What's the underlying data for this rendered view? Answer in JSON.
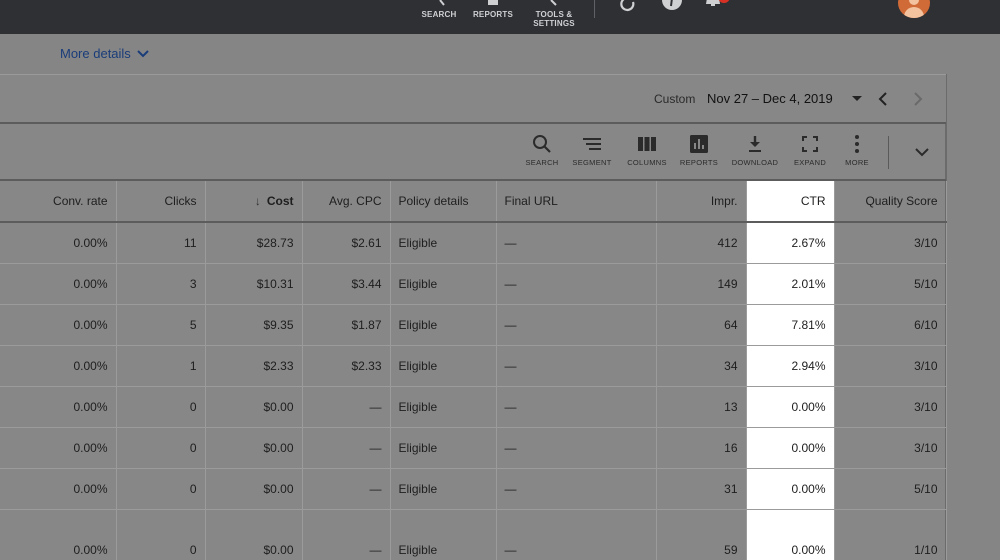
{
  "topnav": {
    "items": [
      {
        "label": "SEARCH",
        "icon": "search-icon"
      },
      {
        "label": "REPORTS",
        "icon": "reports-icon"
      },
      {
        "label": "TOOLS &",
        "label2": "SETTINGS",
        "icon": "wrench-icon"
      }
    ],
    "notification_badge_color": "#d93025"
  },
  "more_details": {
    "label": "More details"
  },
  "date_range": {
    "prefix": "Custom",
    "value": "Nov 27 – Dec 4, 2019"
  },
  "toolbar": {
    "items": [
      {
        "label": "SEARCH",
        "icon": "search-icon"
      },
      {
        "label": "SEGMENT",
        "icon": "segment-icon"
      },
      {
        "label": "COLUMNS",
        "icon": "columns-icon"
      },
      {
        "label": "REPORTS",
        "icon": "reports-chart-icon"
      },
      {
        "label": "DOWNLOAD",
        "icon": "download-icon"
      },
      {
        "label": "EXPAND",
        "icon": "expand-icon"
      },
      {
        "label": "MORE",
        "icon": "more-vert-icon"
      }
    ]
  },
  "table": {
    "columns": [
      "Conv. rate",
      "Clicks",
      "Cost",
      "Avg. CPC",
      "Policy details",
      "Final URL",
      "Impr.",
      "CTR",
      "Quality Score"
    ],
    "sorted_column": "Cost",
    "highlight_color": "#ffffff",
    "rows": [
      [
        "0.00%",
        "11",
        "$28.73",
        "$2.61",
        "Eligible",
        "—",
        "412",
        "2.67%",
        "3/10"
      ],
      [
        "0.00%",
        "3",
        "$10.31",
        "$3.44",
        "Eligible",
        "—",
        "149",
        "2.01%",
        "5/10"
      ],
      [
        "0.00%",
        "5",
        "$9.35",
        "$1.87",
        "Eligible",
        "—",
        "64",
        "7.81%",
        "6/10"
      ],
      [
        "0.00%",
        "1",
        "$2.33",
        "$2.33",
        "Eligible",
        "—",
        "34",
        "2.94%",
        "3/10"
      ],
      [
        "0.00%",
        "0",
        "$0.00",
        "—",
        "Eligible",
        "—",
        "13",
        "0.00%",
        "3/10"
      ],
      [
        "0.00%",
        "0",
        "$0.00",
        "—",
        "Eligible",
        "—",
        "16",
        "0.00%",
        "3/10"
      ],
      [
        "0.00%",
        "0",
        "$0.00",
        "—",
        "Eligible",
        "—",
        "31",
        "0.00%",
        "5/10"
      ],
      [
        "0.00%",
        "0",
        "$0.00",
        "—",
        "Eligible",
        "—",
        "59",
        "0.00%",
        "1/10"
      ]
    ]
  }
}
